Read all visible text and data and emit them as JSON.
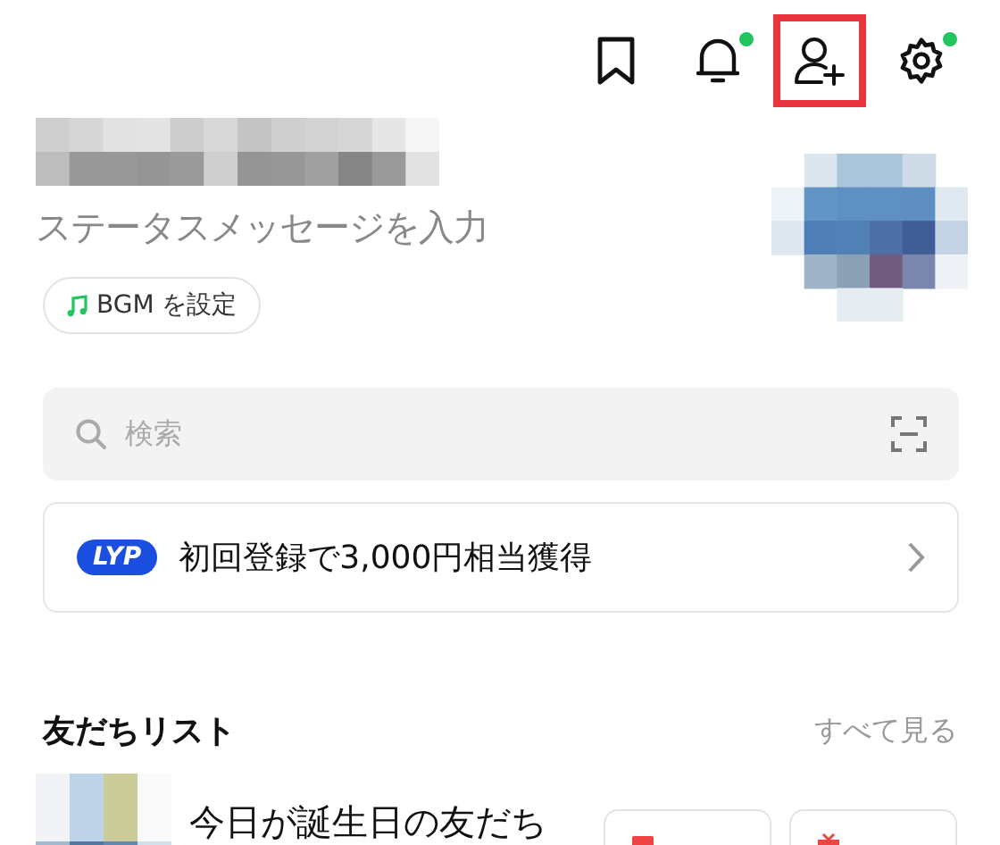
{
  "header_icons": [
    {
      "kind": "bookmark",
      "badge": false,
      "highlighted": false
    },
    {
      "kind": "bell",
      "badge": true,
      "highlighted": false
    },
    {
      "kind": "add-friend",
      "badge": false,
      "highlighted": true
    },
    {
      "kind": "gear",
      "badge": true,
      "highlighted": false
    }
  ],
  "profile": {
    "status_placeholder": "ステータスメッセージを入力",
    "bgm_button": "BGM を設定"
  },
  "search": {
    "placeholder": "検索"
  },
  "promo": {
    "logo": "LYP",
    "text": "初回登録で3,000円相当獲得"
  },
  "friends": {
    "title": "友だちリスト",
    "see_all": "すべて見る",
    "birthday_row": {
      "text": "今日が誕生日の友だち",
      "buttons": [
        {
          "kind": "card"
        },
        {
          "kind": "gift"
        }
      ]
    }
  }
}
